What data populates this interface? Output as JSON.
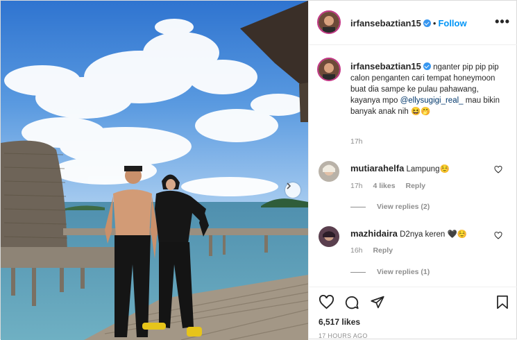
{
  "header": {
    "username": "irfansebaztian15",
    "separator": "•",
    "follow_label": "Follow",
    "more_label": "•••"
  },
  "caption": {
    "username": "irfansebaztian15",
    "text_before": "nganter pip pip pip calon penganten cari tempat honeymoon buat dia sampe ke pulau pahawang,",
    "text_line2": "kayanya mpo",
    "mention": "@ellysugigi_real_",
    "text_after": "mau bikin banyak anak nih 😆🤭",
    "time": "17h"
  },
  "comments": [
    {
      "username": "mutiarahelfa",
      "text": "Lampung☺️",
      "time": "17h",
      "likes": "4 likes",
      "reply_label": "Reply",
      "view_replies": "View replies (2)"
    },
    {
      "username": "mazhidaira",
      "text": "D2nya keren 🖤☺️",
      "time": "16h",
      "reply_label": "Reply",
      "view_replies": "View replies (1)"
    }
  ],
  "footer": {
    "likes": "6,517 likes",
    "posted_ago": "17 HOURS AGO"
  },
  "icons": {
    "like": "heart-icon",
    "comment": "comment-icon",
    "share": "share-icon",
    "save": "bookmark-icon",
    "next": "chevron-right-icon"
  },
  "colors": {
    "link_blue": "#0095f6",
    "mention_blue": "#00376b",
    "muted": "#8e8e8e",
    "text": "#262626"
  }
}
